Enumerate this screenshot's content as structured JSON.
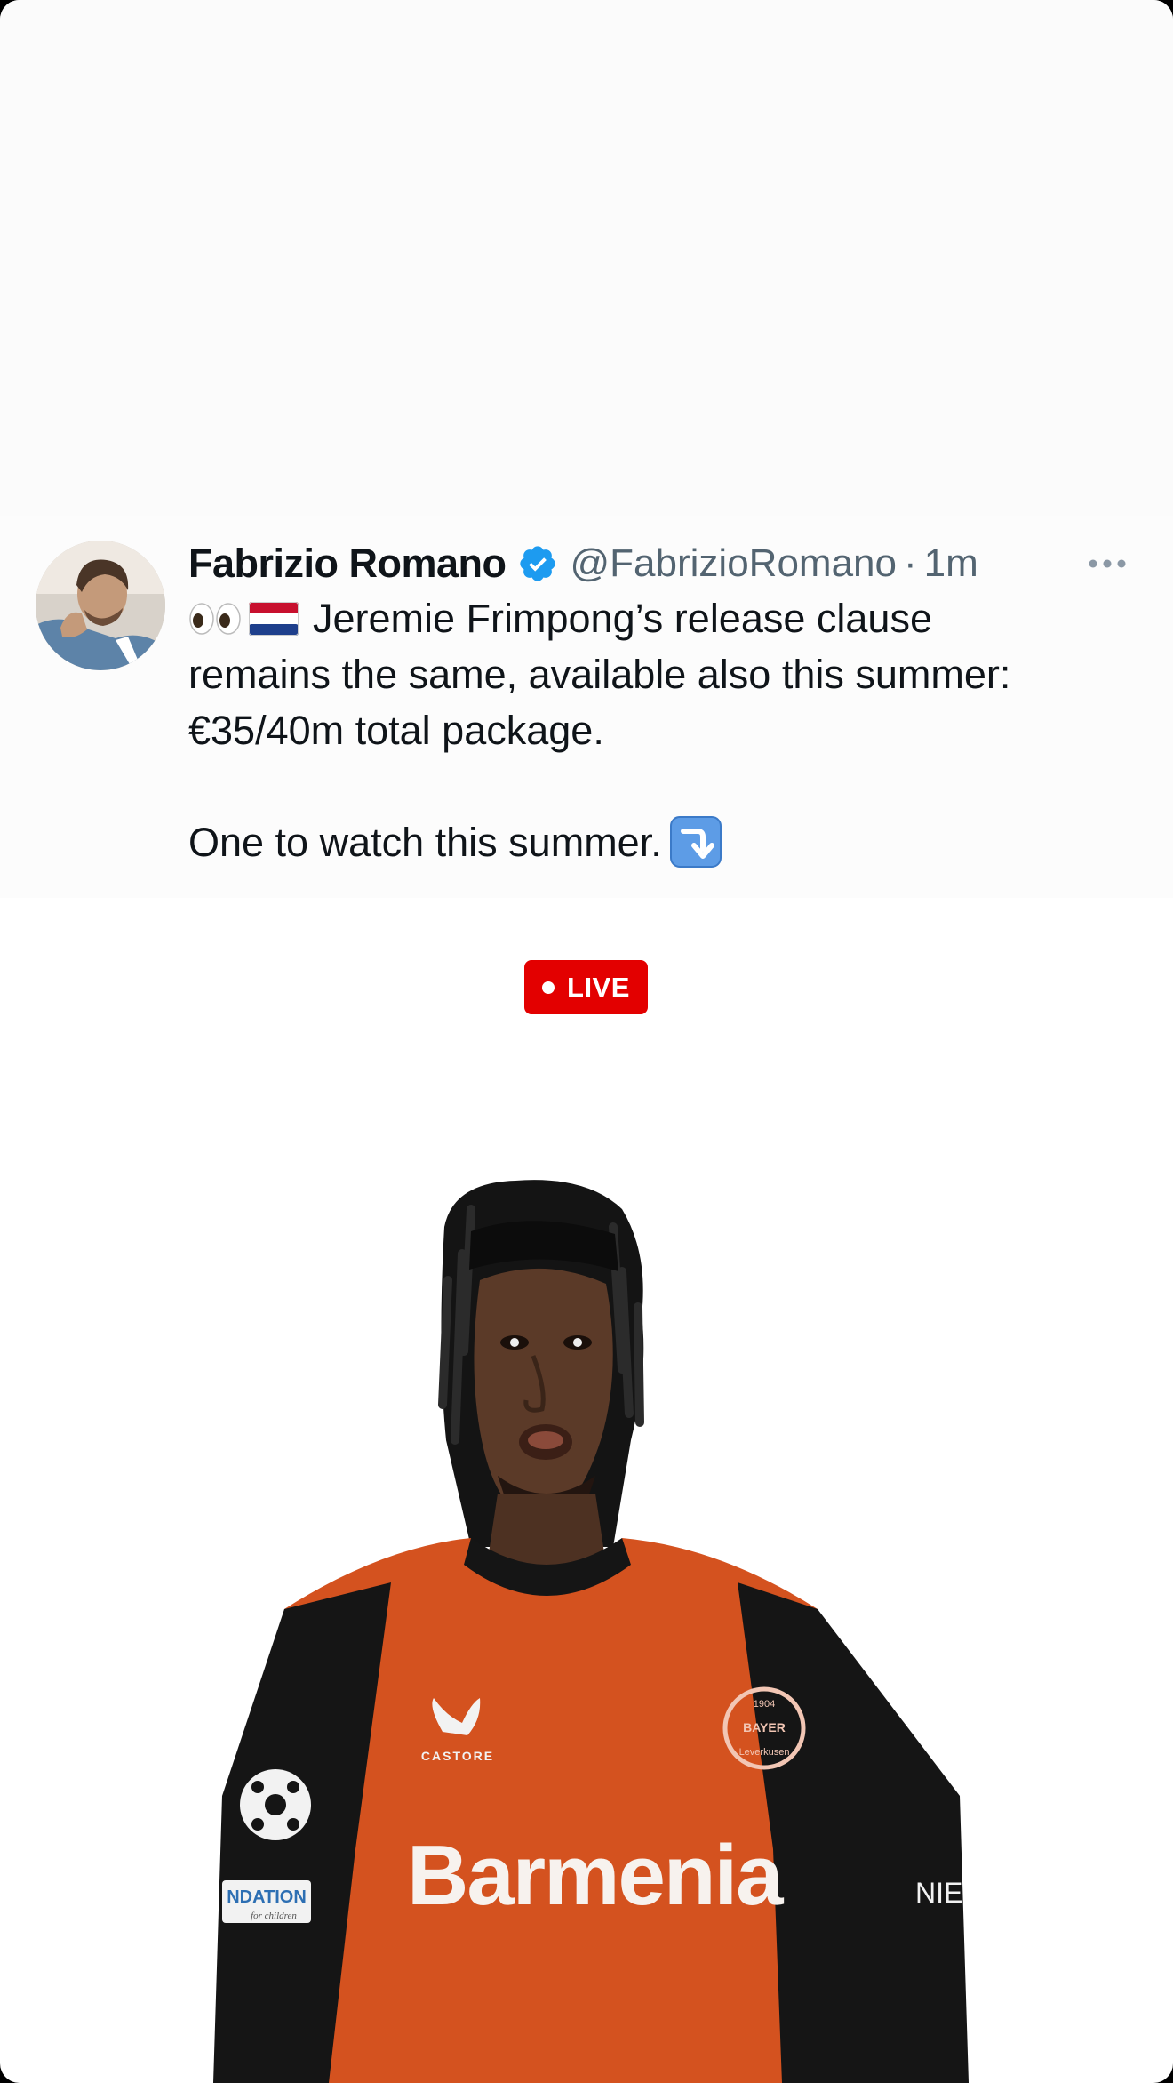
{
  "tweet": {
    "author_name": "Fabrizio Romano",
    "handle": "@FabrizioRomano",
    "separator": "·",
    "timestamp": "1m",
    "verified": true,
    "lines": [
      "Jeremie Frimpong’s release clause",
      "remains the same, available also this summer:",
      "€35/40m total package.",
      "One to watch this summer."
    ],
    "emojis": [
      "eyes-emoji",
      "netherlands-flag-emoji",
      "arrow-down-emoji"
    ]
  },
  "badge": {
    "label": "LIVE",
    "color": "#e30000"
  },
  "photo": {
    "sponsor_text": "Barmenia",
    "kit_brand": "CASTORE",
    "sleeve_patch": "NDATION",
    "sleeve_patch_sub": "for children",
    "right_sleeve": "NIE",
    "crest_text": "BAYER",
    "crest_sub": "Leverkusen",
    "crest_year": "1904"
  },
  "colors": {
    "verified": "#1d9bf0",
    "name": "#0f1419",
    "meta": "#536471",
    "kit_orange": "#d4521f",
    "kit_black": "#151515"
  }
}
